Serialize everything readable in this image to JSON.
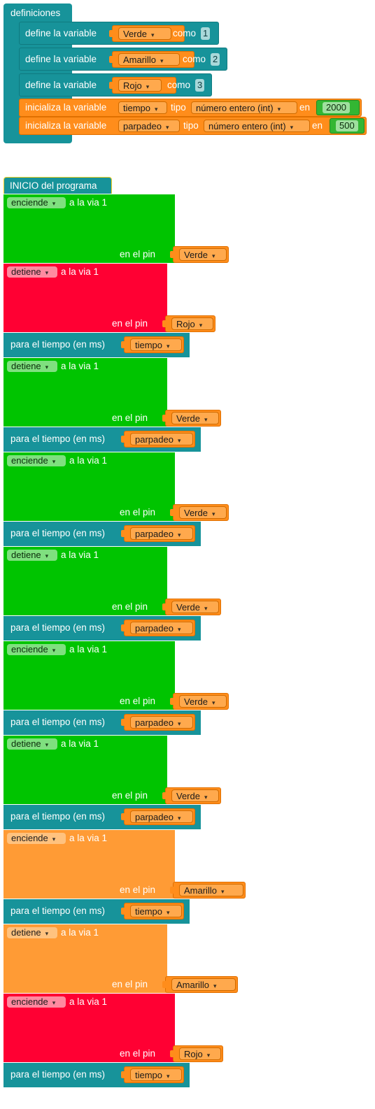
{
  "definitions": {
    "header": "definiciones",
    "define_label": "define la variable",
    "as_label": "como",
    "init_label": "inicializa la variable",
    "type_label": "tipo",
    "in_label": "en",
    "defines": [
      {
        "var": "Verde",
        "value": "1"
      },
      {
        "var": "Amarillo",
        "value": "2"
      },
      {
        "var": "Rojo",
        "value": "3"
      }
    ],
    "inits": [
      {
        "var": "tiempo",
        "type": "número entero (int)",
        "value": "2000"
      },
      {
        "var": "parpadeo",
        "type": "número entero (int)",
        "value": "500"
      }
    ]
  },
  "program": {
    "header": "INICIO del programa",
    "via_label": "a la via 1",
    "pin_label": "en el pin",
    "wait_label": "para el tiempo  (en ms)",
    "blocks": [
      {
        "kind": "relay",
        "action": "enciende",
        "pin": "Verde"
      },
      {
        "kind": "relay",
        "action": "detiene",
        "pin": "Rojo"
      },
      {
        "kind": "wait",
        "var": "tiempo"
      },
      {
        "kind": "relay",
        "action": "detiene",
        "pin": "Verde"
      },
      {
        "kind": "wait",
        "var": "parpadeo"
      },
      {
        "kind": "relay",
        "action": "enciende",
        "pin": "Verde"
      },
      {
        "kind": "wait",
        "var": "parpadeo"
      },
      {
        "kind": "relay",
        "action": "detiene",
        "pin": "Verde"
      },
      {
        "kind": "wait",
        "var": "parpadeo"
      },
      {
        "kind": "relay",
        "action": "enciende",
        "pin": "Verde"
      },
      {
        "kind": "wait",
        "var": "parpadeo"
      },
      {
        "kind": "relay",
        "action": "detiene",
        "pin": "Verde"
      },
      {
        "kind": "wait",
        "var": "parpadeo"
      },
      {
        "kind": "relay",
        "action": "enciende",
        "pin": "Amarillo"
      },
      {
        "kind": "wait",
        "var": "tiempo"
      },
      {
        "kind": "relay",
        "action": "detiene",
        "pin": "Amarillo"
      },
      {
        "kind": "relay",
        "action": "enciende",
        "pin": "Rojo"
      },
      {
        "kind": "wait",
        "var": "tiempo"
      }
    ]
  },
  "colors": {
    "teal": "#17939a",
    "orange": "#ff8d1b",
    "green": "#00c400",
    "red": "#ff0033",
    "light_orange": "#ff9b35"
  }
}
